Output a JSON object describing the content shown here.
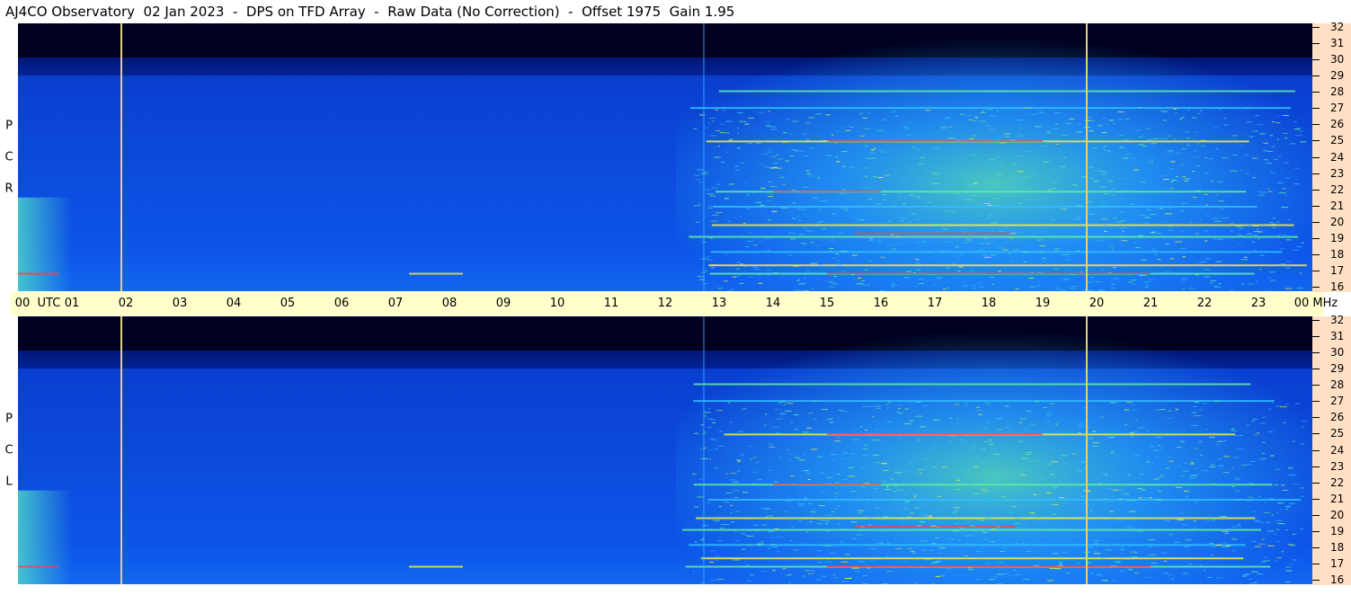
{
  "title": "AJ4CO Observatory  02 Jan 2023  -  DPS on TFD Array  -  Raw Data (No Correction)  -  Offset 1975  Gain 1.95",
  "chart_data": [
    {
      "type": "heatmap",
      "panel": "RCP",
      "polarization_letters": [
        "R",
        "C",
        "P"
      ],
      "x_axis": {
        "unit": "UTC",
        "range_hours": [
          0,
          24
        ]
      },
      "y_axis": {
        "unit": "MHz",
        "range": [
          16,
          32
        ]
      },
      "markers_utc_hours": [
        1.9,
        19.8
      ]
    },
    {
      "type": "heatmap",
      "panel": "LCP",
      "polarization_letters": [
        "L",
        "C",
        "P"
      ],
      "x_axis": {
        "unit": "UTC",
        "range_hours": [
          0,
          24
        ]
      },
      "y_axis": {
        "unit": "MHz",
        "range": [
          16,
          32
        ]
      },
      "markers_utc_hours": [
        1.9,
        19.8
      ]
    }
  ],
  "utc_ticks": [
    "00  UTC",
    "01",
    "02",
    "03",
    "04",
    "05",
    "06",
    "07",
    "08",
    "09",
    "10",
    "11",
    "12",
    "13",
    "14",
    "15",
    "16",
    "17",
    "18",
    "19",
    "20",
    "21",
    "22",
    "23",
    "00 MHz"
  ],
  "freq_ticks": [
    "32",
    "31",
    "30",
    "29",
    "28",
    "27",
    "26",
    "25",
    "24",
    "23",
    "22",
    "21",
    "20",
    "19",
    "18",
    "17",
    "16"
  ],
  "colors": {
    "dark": "#000020",
    "blue": "#0a3fd0",
    "cyan": "#30c0ff",
    "green": "#60f0a0",
    "yellow": "#f0f040",
    "red": "#ff4040",
    "marker": "#e0d080",
    "axis_bg": "#ffffcc",
    "freq_bg": "#ffe0c4"
  }
}
